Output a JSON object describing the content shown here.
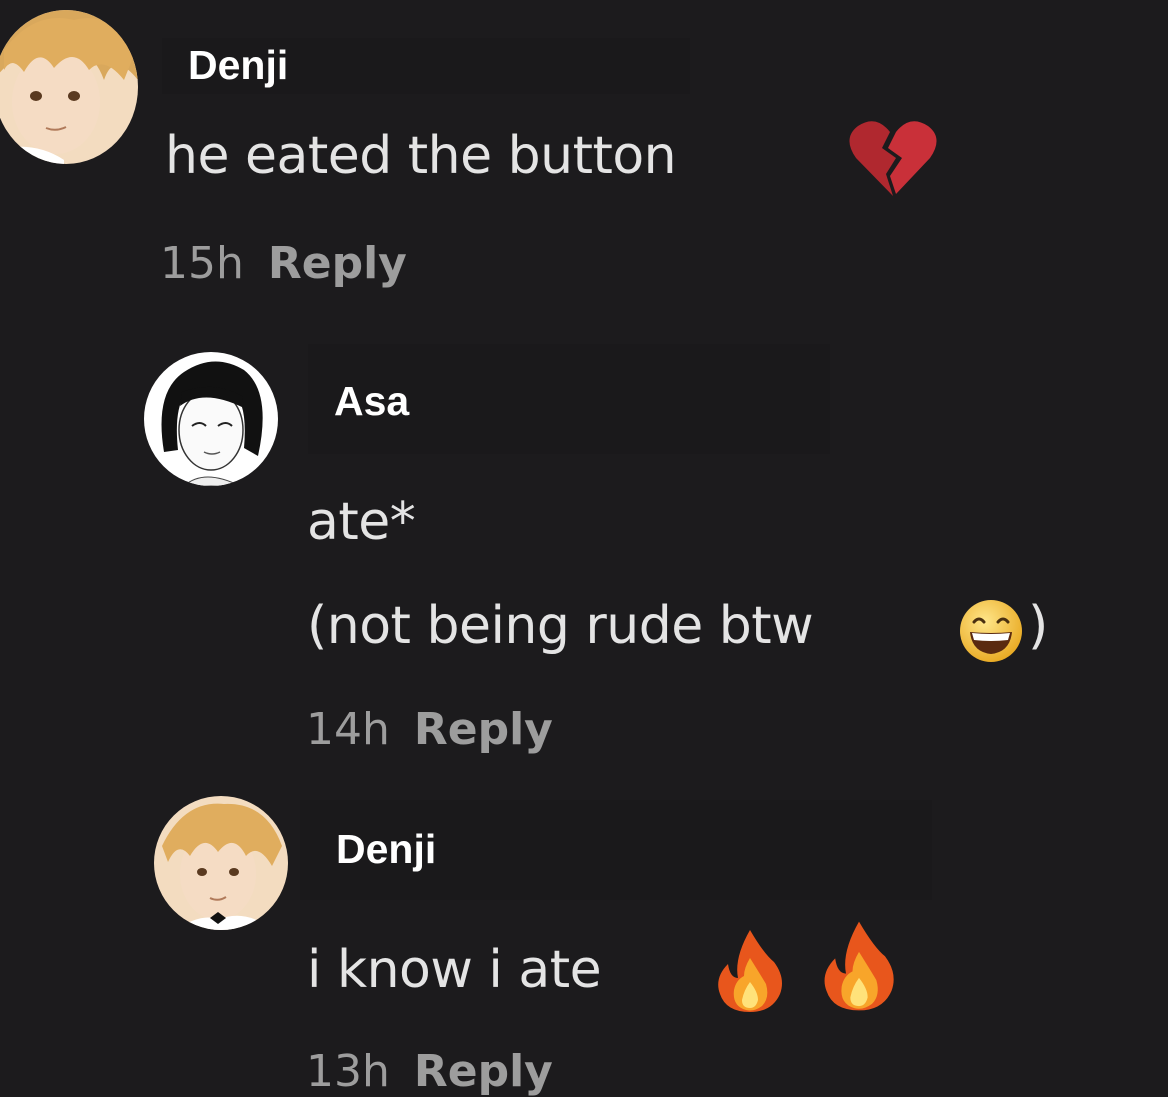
{
  "comments": [
    {
      "username": "Denji",
      "lines": [
        "he eated the button"
      ],
      "emoji": "broken-heart-icon",
      "time": "15h",
      "reply_label": "Reply"
    },
    {
      "username": "Asa",
      "lines": [
        "ate*",
        "(not being rude btw",
        ")"
      ],
      "emoji": "grinning-face-icon",
      "time": "14h",
      "reply_label": "Reply"
    },
    {
      "username": "Denji",
      "lines": [
        "i know i ate"
      ],
      "emoji": "fire-icon",
      "time": "13h",
      "reply_label": "Reply"
    }
  ],
  "colors": {
    "background": "#1c1b1d",
    "name_box": "#1a191b",
    "text": "#e4e4e4",
    "meta": "#9d9d9d"
  }
}
